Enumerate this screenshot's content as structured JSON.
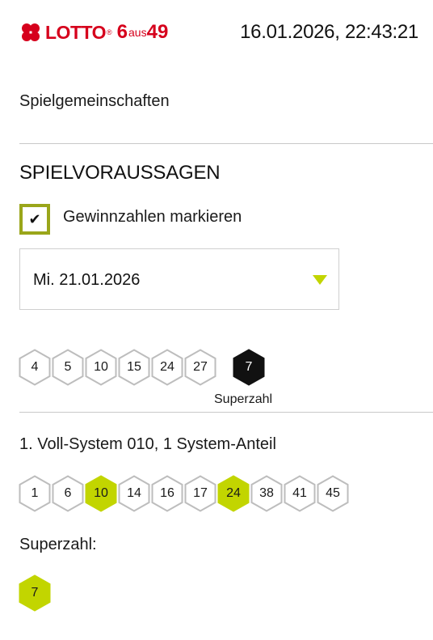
{
  "header": {
    "logo": {
      "word": "LOTTO",
      "reg": "®",
      "six": "6",
      "aus": "aus",
      "fortynine": "49"
    },
    "datetime": "16.01.2026, 22:43:21"
  },
  "spielgemeinschaften_label": "Spielgemeinschaften",
  "section_title": "SPIELVORAUSSAGEN",
  "mark_winning": {
    "label": "Gewinnzahlen markieren",
    "checked": true
  },
  "draw_select": {
    "value": "Mi. 21.01.2026"
  },
  "draw_result": {
    "numbers": [
      "4",
      "5",
      "10",
      "15",
      "24",
      "27"
    ],
    "superzahl": "7",
    "superzahl_caption": "Superzahl"
  },
  "system": {
    "label": "1. Voll-System 010, 1 System-Anteil",
    "numbers": [
      {
        "value": "1",
        "hit": false
      },
      {
        "value": "6",
        "hit": false
      },
      {
        "value": "10",
        "hit": true
      },
      {
        "value": "14",
        "hit": false
      },
      {
        "value": "16",
        "hit": false
      },
      {
        "value": "17",
        "hit": false
      },
      {
        "value": "24",
        "hit": true
      },
      {
        "value": "38",
        "hit": false
      },
      {
        "value": "41",
        "hit": false
      },
      {
        "value": "45",
        "hit": false
      }
    ]
  },
  "superzahl": {
    "label": "Superzahl:",
    "value": "7",
    "hit": true
  },
  "colors": {
    "accent_green": "#c2d500",
    "checkbox_border": "#9aa61a",
    "logo_red": "#d6001c",
    "hex_border": "#bdbdbd",
    "hex_dark": "#111111"
  }
}
